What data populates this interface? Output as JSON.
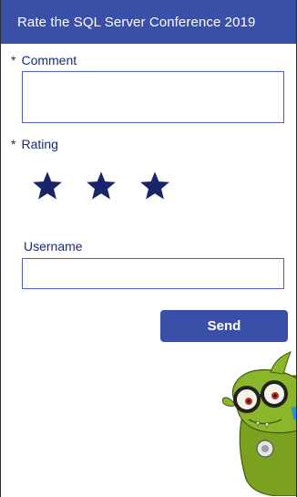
{
  "header": {
    "title": "Rate the SQL Server Conference 2019"
  },
  "form": {
    "required_marker": "*",
    "comment_label": "Comment",
    "comment_value": "",
    "rating_label": "Rating",
    "rating_value": 3,
    "rating_max": 3,
    "username_label": "Username",
    "username_value": ""
  },
  "actions": {
    "send_label": "Send"
  },
  "colors": {
    "header_bg": "#3a4fa7",
    "accent": "#4a5fbf",
    "star": "#1a2469",
    "label_text": "#1d2a6b"
  },
  "icons": {
    "star": "star-icon",
    "mascot": "mascot-illustration"
  }
}
